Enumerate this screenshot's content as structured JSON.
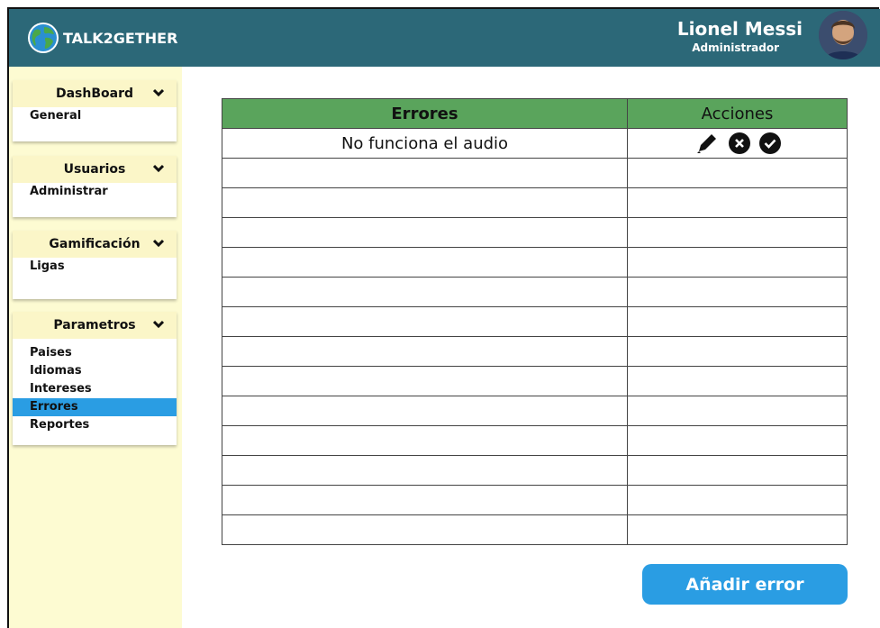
{
  "app": {
    "logo_text": "TALK2GETHER"
  },
  "user": {
    "name": "Lionel Messi",
    "role": "Administrador"
  },
  "sidebar": {
    "groups": [
      {
        "title": "DashBoard",
        "items": [
          "General"
        ]
      },
      {
        "title": "Usuarios",
        "items": [
          "Administrar"
        ]
      },
      {
        "title": "Gamificación",
        "items": [
          "Ligas"
        ]
      },
      {
        "title": "Parametros",
        "items": [
          "Paises",
          "Idiomas",
          "Intereses",
          "Errores",
          "Reportes"
        ],
        "active": "Errores"
      }
    ]
  },
  "table": {
    "headers": [
      "Errores",
      "Acciones"
    ],
    "rows": [
      {
        "error": "No funciona el audio",
        "actions": [
          "pencil-icon",
          "close-circle-icon",
          "check-circle-icon"
        ]
      },
      {
        "error": ""
      },
      {
        "error": ""
      },
      {
        "error": ""
      },
      {
        "error": ""
      },
      {
        "error": ""
      },
      {
        "error": ""
      },
      {
        "error": ""
      },
      {
        "error": ""
      },
      {
        "error": ""
      },
      {
        "error": ""
      },
      {
        "error": ""
      },
      {
        "error": ""
      },
      {
        "error": ""
      }
    ]
  },
  "add_button": {
    "label": "Añadir error"
  },
  "colors": {
    "header_bg": "#2c6878",
    "sidebar_bg": "#fdfbd2",
    "table_header": "#5aa45c",
    "accent": "#2a9de3"
  }
}
